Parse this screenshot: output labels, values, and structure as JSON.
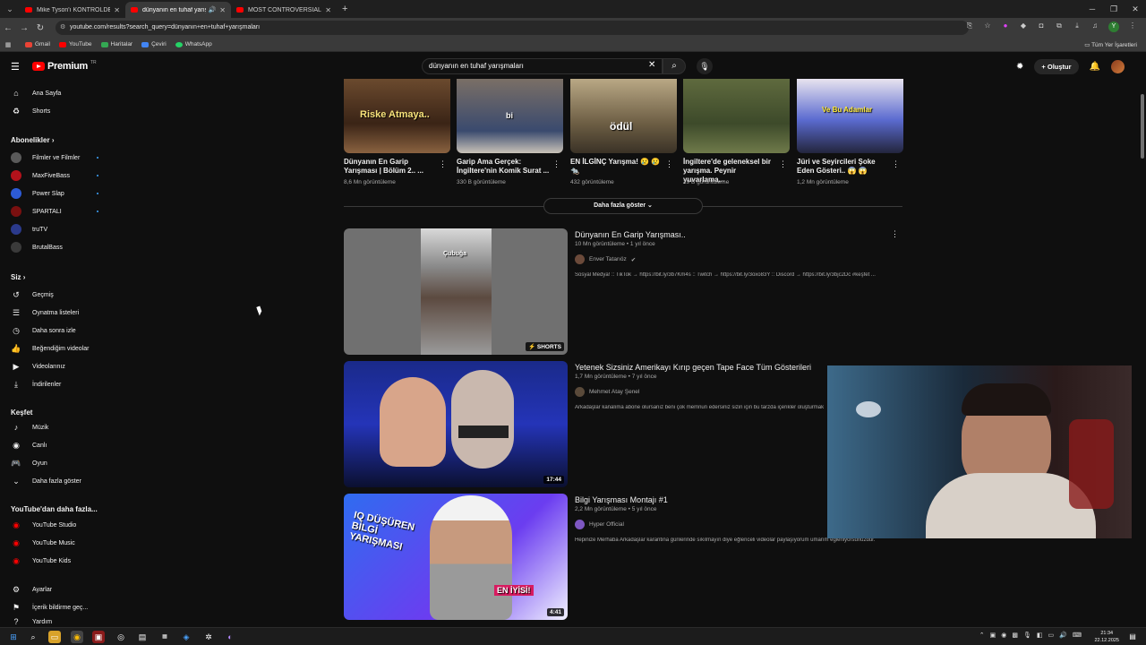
{
  "browser": {
    "tabs": [
      {
        "title": "Mike Tyson'ı KONTROLDEN Ç",
        "active": false
      },
      {
        "title": "dünyanın en tuhaf yarışm",
        "active": true
      },
      {
        "title": "MOST CONTROVERSIAL Power",
        "active": false
      }
    ],
    "url": "youtube.com/results?search_query=dünyanın+en+tuhaf+yarışmaları",
    "bookmarks": [
      "Gmail",
      "YouTube",
      "Haritalar",
      "Çeviri",
      "WhatsApp"
    ],
    "bookmarks_right": "Tüm Yer İşaretleri",
    "profile_letter": "Y"
  },
  "header": {
    "logo_text": "Premium",
    "logo_country": "TR",
    "search_value": "dünyanın en tuhaf yarışmaları",
    "create_label": "Oluştur"
  },
  "sidebar": {
    "main": [
      "Ana Sayfa",
      "Shorts"
    ],
    "subs_heading": "Abonelikler",
    "subs": [
      "Filmler ve Filmler",
      "MaxFiveBass",
      "Power Slap",
      "SPARTALI",
      "truTV",
      "BrutalBass"
    ],
    "you_heading": "Siz",
    "you": [
      "Geçmiş",
      "Oynatma listeleri",
      "Daha sonra izle",
      "Beğendiğim videolar",
      "Videolarınız",
      "İndirilenler"
    ],
    "explore_heading": "Keşfet",
    "explore": [
      "Müzik",
      "Canlı",
      "Oyun",
      "Daha fazla göster"
    ],
    "more_heading": "YouTube'dan daha fazla...",
    "more": [
      "YouTube Studio",
      "YouTube Music",
      "YouTube Kids"
    ],
    "bottom": [
      "Ayarlar",
      "İçerik bildirme geç...",
      "Yardım"
    ]
  },
  "shorts_row": [
    {
      "caption": "Riske Atmaya..",
      "title": "Dünyanın En Garip Yarışması | Bölüm 2.. ...",
      "views": "8,6 Mn görüntüleme"
    },
    {
      "caption": "bi",
      "title": "Garip Ama Gerçek: İngiltere'nin Komik Surat ...",
      "views": "330 B görüntüleme"
    },
    {
      "caption": "ödül",
      "title": "EN İLGİNÇ Yarışma! 😢 😢 🐀",
      "views": "432 görüntüleme"
    },
    {
      "caption": "",
      "title": "İngiltere'de geleneksel bir yarışma. Peynir yuvarlama...",
      "views": "19 B görüntüleme"
    },
    {
      "caption": "Ve Bu Adamlar",
      "title": "Jüri ve Seyircileri Şoke Eden Gösteri.. 😱 😱",
      "views": "1,2 Mn görüntüleme"
    }
  ],
  "show_more": "Daha fazla göster",
  "videos": [
    {
      "title": "Dünyanın En Garip Yarışması..",
      "meta": "10 Mn görüntüleme • 1 yıl önce",
      "channel": "Enver Tatarıöz",
      "desc": "Sosyal Medya! :: TikTok → https://bit.ly/3b7Km4s :: Twitch → https://bit.ly/3oxo83Y :: Discord → https://bit.ly/3bjc2Dc #keşfet ...",
      "badge": "SHORTS",
      "caption": "Çubuğa"
    },
    {
      "title": "Yetenek Sizsiniz Amerikayı Kırıp geçen Tape Face Tüm Gösterileri",
      "meta": "1,7 Mn görüntüleme • 7 yıl önce",
      "channel": "Mehmet Atay Şenel",
      "desc": "Arkadaşlar kanalıma abone olursanız beni çok memnun edersiniz sizin için bu tarzda içerikler oluşturmak i",
      "badge": "17:44"
    },
    {
      "title": "Bilgi Yarışması Montajı #1",
      "meta": "2,2 Mn görüntüleme • 5 yıl önce",
      "channel": "Hyper Official",
      "desc": "Hepinize Merhaba Arkadaşlar karantina günlerinde sıkılmayın diye eğlenceli videolar paylaşıyorum umarım eğleniyorsunuzdur.",
      "badge": "4:41",
      "caption1": "IQ DÜŞÜREN BİLGİ YARIŞMASI",
      "caption2": "EN İYİSİ!"
    }
  ],
  "clock": {
    "time": "21:34",
    "date": "22.12.2025"
  },
  "colors": {
    "accent": "#ff0000",
    "background": "#0f0f0f",
    "link": "#3ea6ff"
  }
}
